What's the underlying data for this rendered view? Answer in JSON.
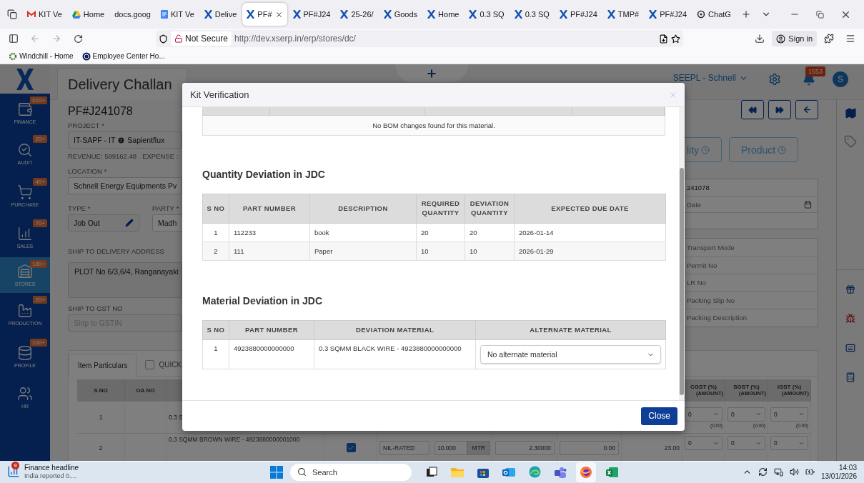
{
  "browser": {
    "tabs": [
      {
        "kind": "gmail",
        "label": "KIT Ve",
        "selected": false
      },
      {
        "kind": "drive",
        "label": "Home",
        "selected": false
      },
      {
        "kind": "none",
        "label": "docs.goog",
        "selected": false
      },
      {
        "kind": "docs",
        "label": "KIT Ve",
        "selected": false
      },
      {
        "kind": "xserp",
        "label": "Delive",
        "selected": false
      },
      {
        "kind": "xserp",
        "label": "PF#",
        "selected": true
      },
      {
        "kind": "xserp",
        "label": "PF#J24",
        "selected": false
      },
      {
        "kind": "xserp",
        "label": "25-26/",
        "selected": false
      },
      {
        "kind": "xserp",
        "label": "Goods",
        "selected": false
      },
      {
        "kind": "xserp",
        "label": "Home",
        "selected": false
      },
      {
        "kind": "xserp",
        "label": "0.3 SQ",
        "selected": false
      },
      {
        "kind": "xserp",
        "label": "0.3 SQ",
        "selected": false
      },
      {
        "kind": "xserp",
        "label": "PF#J24",
        "selected": false
      },
      {
        "kind": "xserp",
        "label": "TMP#",
        "selected": false
      },
      {
        "kind": "xserp",
        "label": "PF#J24",
        "selected": false
      },
      {
        "kind": "chatgpt",
        "label": "ChatG",
        "selected": false
      }
    ],
    "security": "Not Secure",
    "url": "http://dev.xserp.in/erp/stores/dc/",
    "sign_in": "Sign in",
    "bookmarks": [
      {
        "kind": "windchill",
        "label": "Windchill - Home"
      },
      {
        "kind": "employee",
        "label": "Employee Center Ho..."
      }
    ]
  },
  "app": {
    "title": "Delivery Challan",
    "org": "SEEPL - Schnell",
    "notifications": "1553",
    "avatar": "S",
    "modules": [
      {
        "label": "FINANCE",
        "badge": "210+",
        "selected": false
      },
      {
        "label": "AUDIT",
        "badge": "20+",
        "selected": false
      },
      {
        "label": "PURCHASE",
        "badge": "40+",
        "selected": false
      },
      {
        "label": "SALES",
        "badge": "70+",
        "selected": false
      },
      {
        "label": "STORES",
        "badge": "180+",
        "selected": true
      },
      {
        "label": "PRODUCTION",
        "badge": "20+",
        "selected": false
      },
      {
        "label": "PROFILE",
        "badge": "100+",
        "selected": false
      },
      {
        "label": "HR",
        "selected": false
      }
    ],
    "form": {
      "doc_no": "PF#J241078",
      "project": {
        "label": "PROJECT",
        "required_mark": "*",
        "code": "IT-SAPF - IT",
        "name": "Sapientflux"
      },
      "revenue": "REVENUE: 589162.48",
      "expense": "EXPENSE :",
      "location": {
        "label": "LOCATION",
        "required_mark": "*",
        "value": "Schnell Energy Equipments Pv"
      },
      "type": {
        "label": "TYPE",
        "required_mark": "*",
        "value": "Job Out"
      },
      "party": {
        "label": "PARTY",
        "required_mark": "*",
        "value": "Madh"
      },
      "address": {
        "label": "SHIP TO DELIVERY ADDRESS",
        "value": "PLOT No 6/3,6/4, Ranganayaki"
      },
      "gst": {
        "label": "SHIP TO GST NO",
        "placeholder": "Ship to GSTIN"
      }
    },
    "status_buttons": [
      "lity",
      "Product"
    ],
    "details": {
      "doc_ref": "241078",
      "date_placeholder": "Date",
      "placeholders": [
        "Transport Mode",
        "Permit No",
        "LR No",
        "Packing Slip No",
        "Packing Description"
      ]
    },
    "items": {
      "tabs": [
        {
          "label": "Item Particulars",
          "selected": true
        }
      ],
      "quick": {
        "label": "QUICK",
        "checked": false
      },
      "columns_left": [
        "S.NO",
        "OA NO"
      ],
      "tax_columns": [
        {
          "label": "CGST (%)",
          "sub": "(AMOUNT)"
        },
        {
          "label": "SGST (%)",
          "sub": "(AMOUNT)"
        },
        {
          "label": "IGST (%)",
          "sub": "(AMOUNT)"
        }
      ],
      "rows": [
        {
          "sno": "1",
          "item": "0.3 S",
          "taxes": [
            {
              "rate": "0",
              "amount": "(0.00)"
            },
            {
              "rate": "0",
              "amount": "(0.00)"
            },
            {
              "rate": "0",
              "amount": "(0.00)"
            }
          ]
        },
        {
          "sno": "2",
          "item": "0.3 SQMM BROWN WIRE - 4923880000001000",
          "checked": true,
          "tax_type": "NIL-RATED",
          "qty": "10.000",
          "unit": "MTR",
          "rate": "2.30000",
          "discount": "0.00",
          "total": "23.00",
          "taxes": [
            {
              "rate": "0"
            },
            {
              "rate": "0"
            },
            {
              "rate": "0"
            }
          ]
        }
      ]
    }
  },
  "modal": {
    "title": "Kit Verification",
    "bom": {
      "message": "No BOM changes found for this material."
    },
    "quantity": {
      "heading": "Quantity Deviation in JDC",
      "columns": [
        "S NO",
        "PART NUMBER",
        "DESCRIPTION",
        "REQUIRED QUANTITY",
        "DEVIATION QUANTITY",
        "EXPECTED DUE DATE"
      ],
      "rows": [
        [
          "1",
          "112233",
          "book",
          "20",
          "20",
          "2026-01-14"
        ],
        [
          "2",
          "111",
          "Paper",
          "10",
          "10",
          "2026-01-29"
        ]
      ]
    },
    "material": {
      "heading": "Material Deviation in JDC",
      "columns": [
        "S NO",
        "PART NUMBER",
        "DEVIATION MATERIAL",
        "ALTERNATE MATERIAL"
      ],
      "rows": [
        {
          "sno": "1",
          "part": "4923880000000000",
          "material": "0.3 SQMM BLACK WIRE - 4923880000000000",
          "alternate": "No alternate material"
        }
      ]
    },
    "close": "Close"
  },
  "taskbar": {
    "news_badge": "9",
    "news_title": "Finance headline",
    "news_sub": "India reported 0....",
    "search_placeholder": "Search",
    "apps": [
      {
        "kind": "taskview",
        "selected": false
      },
      {
        "kind": "explorer",
        "selected": false
      },
      {
        "kind": "store",
        "selected": false
      },
      {
        "kind": "outlook",
        "selected": false
      },
      {
        "kind": "edge",
        "selected": false
      },
      {
        "kind": "teams",
        "selected": false
      },
      {
        "kind": "firefox",
        "selected": true
      },
      {
        "kind": "excel",
        "selected": false
      }
    ],
    "time": "14:03",
    "date": "13/01/2026"
  }
}
